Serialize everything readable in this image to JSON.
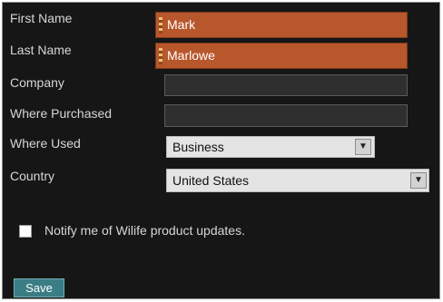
{
  "form": {
    "first_name": {
      "label": "First Name",
      "value": "Mark"
    },
    "last_name": {
      "label": "Last Name",
      "value": "Marlowe"
    },
    "company": {
      "label": "Company",
      "value": ""
    },
    "where_purchased": {
      "label": "Where Purchased",
      "value": ""
    },
    "where_used": {
      "label": "Where Used",
      "selected": "Business"
    },
    "country": {
      "label": "Country",
      "selected": "United States"
    },
    "notify_label": "Notify me of Wilife product updates.",
    "save_label": "Save"
  },
  "colors": {
    "panel_bg": "#161616",
    "accent_orange": "#b8572c",
    "save_bg": "#3b7d85"
  },
  "icons": {
    "dropdown": "chevron-down-icon",
    "field_grip": "grip-icon"
  }
}
